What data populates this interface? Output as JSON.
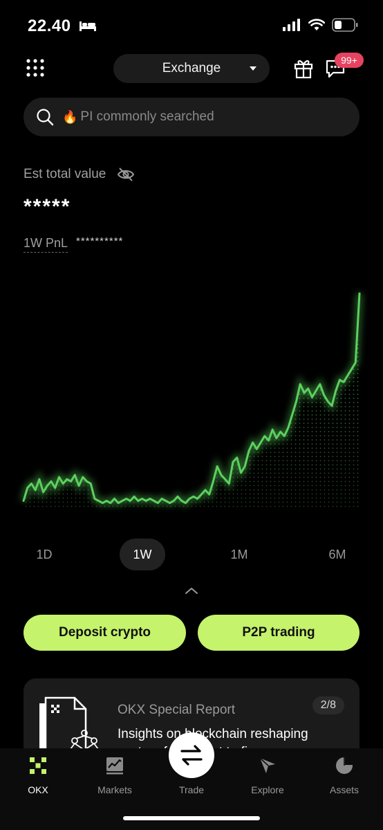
{
  "status_bar": {
    "time": "22.40"
  },
  "header": {
    "exchange_label": "Exchange",
    "badge": "99+"
  },
  "search": {
    "fire": "🔥",
    "text": "PI commonly searched"
  },
  "portfolio": {
    "est_label": "Est total value",
    "est_value": "*****",
    "pnl_label": "1W PnL",
    "pnl_value": "**********"
  },
  "chart_data": {
    "type": "area",
    "values": [
      0.04,
      0.1,
      0.12,
      0.09,
      0.14,
      0.08,
      0.11,
      0.13,
      0.1,
      0.15,
      0.12,
      0.14,
      0.13,
      0.16,
      0.11,
      0.15,
      0.13,
      0.12,
      0.05,
      0.04,
      0.03,
      0.04,
      0.03,
      0.05,
      0.03,
      0.04,
      0.05,
      0.04,
      0.06,
      0.04,
      0.05,
      0.04,
      0.05,
      0.04,
      0.03,
      0.05,
      0.04,
      0.03,
      0.04,
      0.06,
      0.04,
      0.03,
      0.05,
      0.06,
      0.05,
      0.07,
      0.09,
      0.07,
      0.13,
      0.2,
      0.16,
      0.14,
      0.12,
      0.22,
      0.24,
      0.17,
      0.2,
      0.27,
      0.31,
      0.28,
      0.31,
      0.34,
      0.32,
      0.37,
      0.33,
      0.36,
      0.34,
      0.38,
      0.44,
      0.5,
      0.58,
      0.54,
      0.56,
      0.52,
      0.55,
      0.58,
      0.53,
      0.5,
      0.48,
      0.55,
      0.6,
      0.59,
      0.62,
      0.65,
      0.68,
      1.0
    ],
    "color": "#5bd15e"
  },
  "ranges": [
    {
      "label": "1D",
      "active": false
    },
    {
      "label": "1W",
      "active": true
    },
    {
      "label": "1M",
      "active": false
    },
    {
      "label": "6M",
      "active": false
    }
  ],
  "actions": {
    "deposit": "Deposit crypto",
    "p2p": "P2P trading"
  },
  "report": {
    "title": "OKX Special Report",
    "page": "2/8",
    "desc": "Insights on blockchain reshaping sectors from sport to finance"
  },
  "nav": [
    {
      "label": "OKX",
      "icon": "okx-logo-icon",
      "active": true
    },
    {
      "label": "Markets",
      "icon": "markets-chart-icon",
      "active": false
    },
    {
      "label": "Trade",
      "icon": "trade-swap-icon",
      "active": false
    },
    {
      "label": "Explore",
      "icon": "explore-compass-icon",
      "active": false
    },
    {
      "label": "Assets",
      "icon": "assets-pie-icon",
      "active": false
    }
  ],
  "colors": {
    "accent": "#c5f36b",
    "chart_line": "#5bd15e",
    "badge": "#e64360"
  }
}
